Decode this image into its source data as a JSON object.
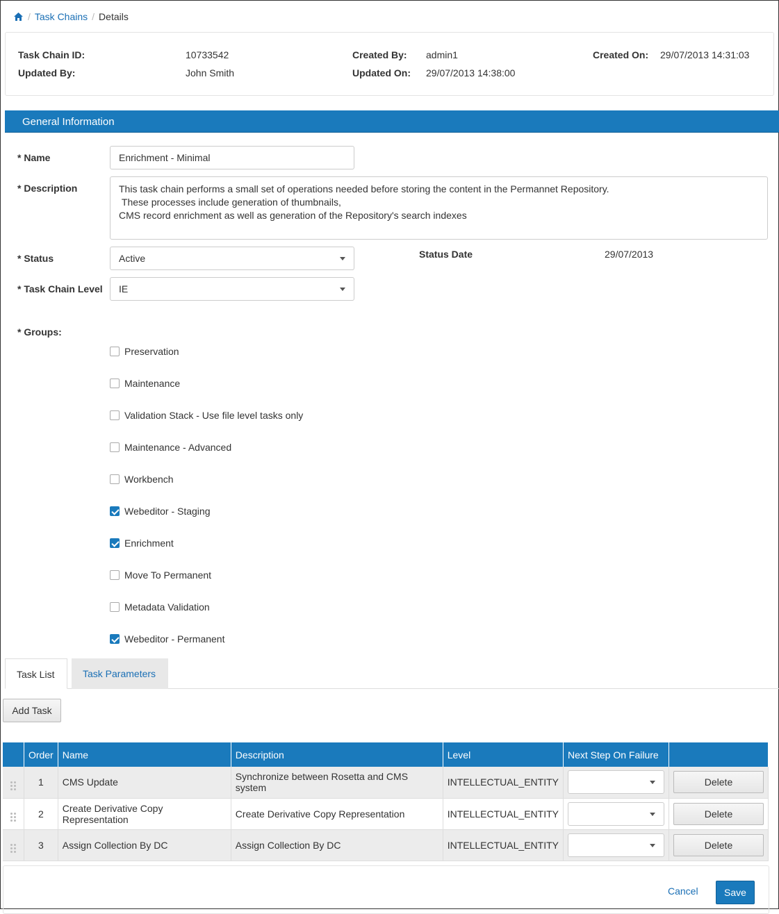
{
  "breadcrumb": {
    "home_icon": "home-icon",
    "items": [
      "Task Chains",
      "Details"
    ]
  },
  "info": {
    "task_chain_id_label": "Task Chain ID:",
    "task_chain_id": "10733542",
    "created_by_label": "Created By:",
    "created_by": "admin1",
    "created_on_label": "Created On:",
    "created_on": "29/07/2013 14:31:03",
    "updated_by_label": "Updated By:",
    "updated_by": "John Smith",
    "updated_on_label": "Updated On:",
    "updated_on": "29/07/2013 14:38:00"
  },
  "section_title": "General Information",
  "form": {
    "name_label": "* Name",
    "name_value": "Enrichment - Minimal",
    "description_label": "* Description",
    "description_value": "This task chain performs a small set of operations needed before storing the content in the Permannet Repository.\n These processes include generation of thumbnails,\nCMS record enrichment as well as generation of the Repository's search indexes",
    "status_label": "* Status",
    "status_value": "Active",
    "status_date_label": "Status Date",
    "status_date": "29/07/2013",
    "level_label": "* Task Chain Level",
    "level_value": "IE",
    "groups_label": "* Groups:",
    "groups": [
      {
        "label": "Preservation",
        "checked": false
      },
      {
        "label": "Maintenance",
        "checked": false
      },
      {
        "label": "Validation Stack - Use file level tasks only",
        "checked": false
      },
      {
        "label": "Maintenance - Advanced",
        "checked": false
      },
      {
        "label": "Workbench",
        "checked": false
      },
      {
        "label": "Webeditor - Staging",
        "checked": true
      },
      {
        "label": "Enrichment",
        "checked": true
      },
      {
        "label": "Move To Permanent",
        "checked": false
      },
      {
        "label": "Metadata Validation",
        "checked": false
      },
      {
        "label": "Webeditor - Permanent",
        "checked": true
      }
    ]
  },
  "tabs": [
    {
      "label": "Task List",
      "active": true
    },
    {
      "label": "Task Parameters",
      "active": false
    }
  ],
  "add_task_label": "Add Task",
  "table": {
    "headers": [
      "",
      "Order",
      "Name",
      "Description",
      "Level",
      "Next Step On Failure",
      ""
    ],
    "rows": [
      {
        "order": "1",
        "name": "CMS Update",
        "description": "Synchronize between Rosetta and CMS system",
        "level": "INTELLECTUAL_ENTITY",
        "next_step": "",
        "action": "Delete"
      },
      {
        "order": "2",
        "name": "Create Derivative Copy Representation",
        "description": "Create Derivative Copy Representation",
        "level": "INTELLECTUAL_ENTITY",
        "next_step": "",
        "action": "Delete"
      },
      {
        "order": "3",
        "name": "Assign Collection By DC",
        "description": "Assign Collection By DC",
        "level": "INTELLECTUAL_ENTITY",
        "next_step": "",
        "action": "Delete"
      }
    ]
  },
  "footer": {
    "cancel_label": "Cancel",
    "save_label": "Save"
  },
  "colors": {
    "accent": "#1a7abc"
  }
}
